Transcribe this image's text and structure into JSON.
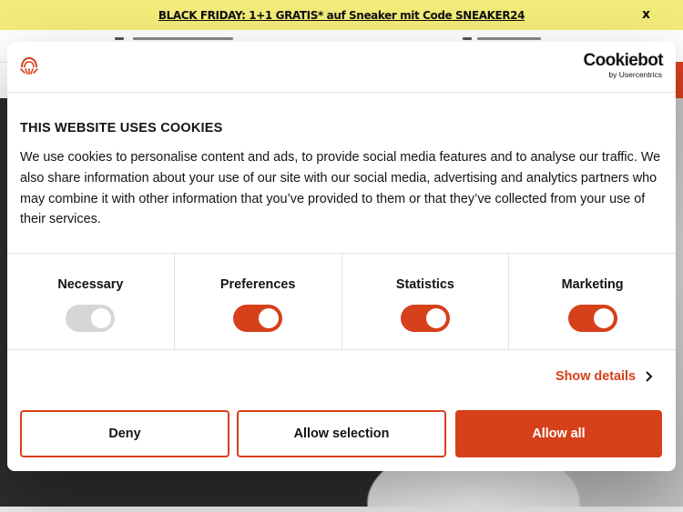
{
  "promo": {
    "text": "BLACK FRIDAY: 1+1 GRATIS* auf Sneaker mit Code SNEAKER24",
    "close": "x",
    "background": "#f3ec7a"
  },
  "cookie_dialog": {
    "brand_logo_icon": "brand-logo-icon",
    "provider": {
      "name": "Cookiebot",
      "subtitle": "by Usercentrics"
    },
    "title": "THIS WEBSITE USES COOKIES",
    "description": "We use cookies to personalise content and ads, to provide social media features and to analyse our traffic. We also share information about your use of our site with our social media, advertising and analytics partners who may combine it with other information that you’ve provided to them or that they’ve collected from your use of their services.",
    "categories": [
      {
        "label": "Necessary",
        "enabled": true,
        "locked": true
      },
      {
        "label": "Preferences",
        "enabled": true,
        "locked": false
      },
      {
        "label": "Statistics",
        "enabled": true,
        "locked": false
      },
      {
        "label": "Marketing",
        "enabled": true,
        "locked": false
      }
    ],
    "show_details": "Show details",
    "buttons": {
      "deny": "Deny",
      "allow_selection": "Allow selection",
      "allow_all": "Allow all"
    },
    "accent_color": "#d6401a"
  }
}
